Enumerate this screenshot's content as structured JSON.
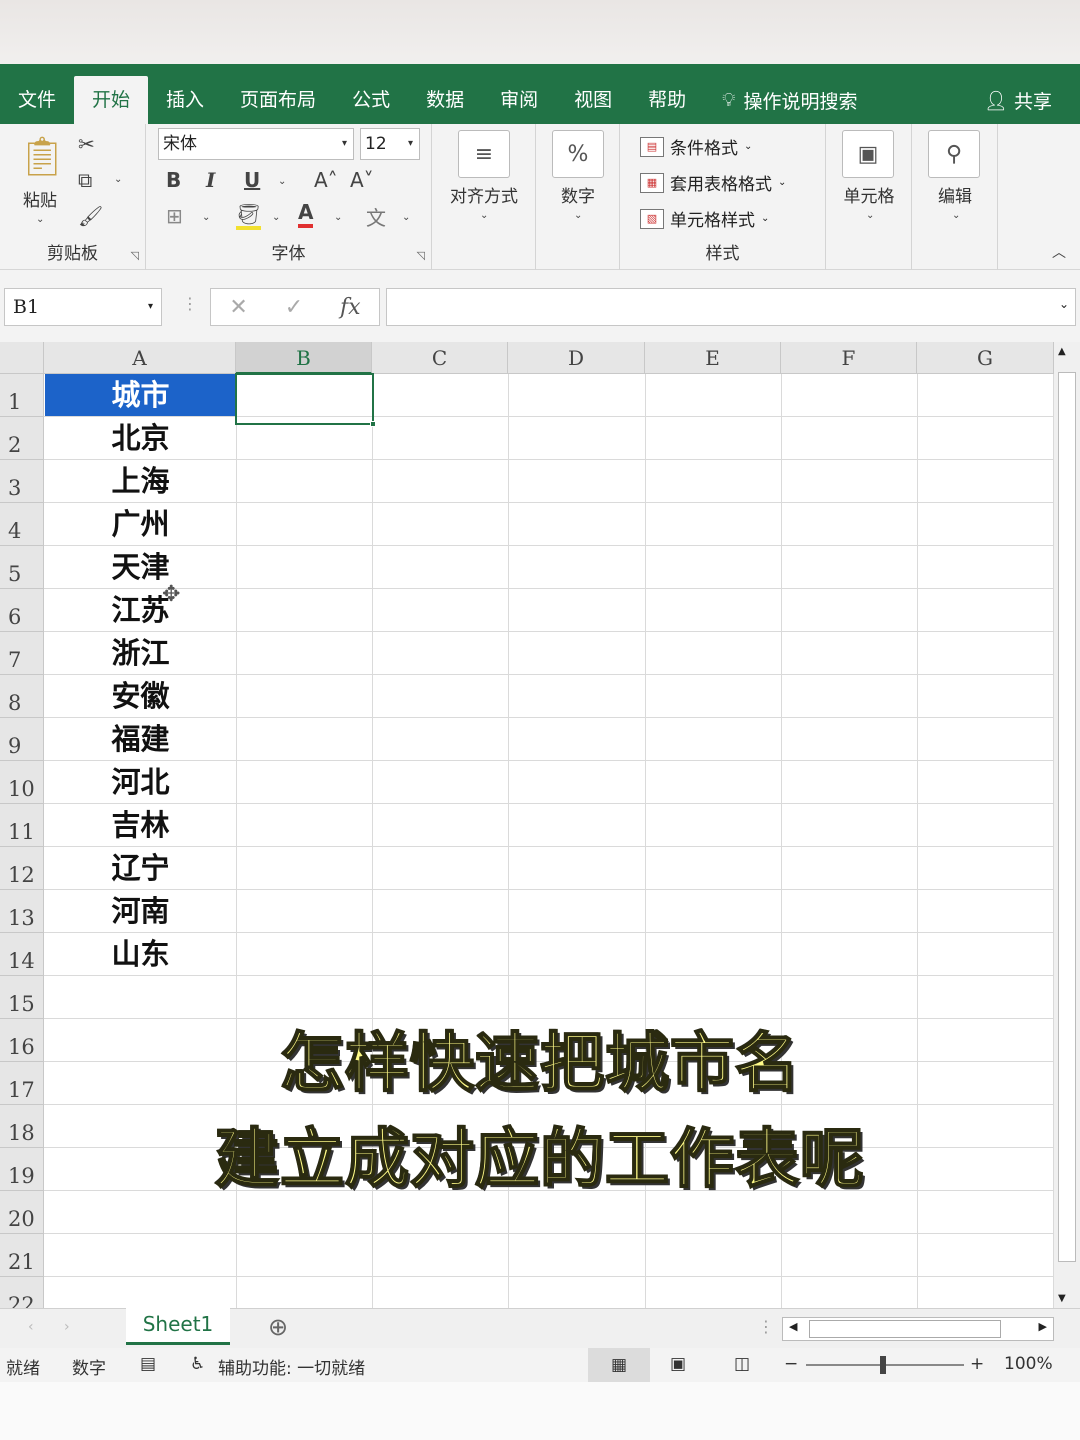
{
  "tabs": [
    "文件",
    "开始",
    "插入",
    "页面布局",
    "公式",
    "数据",
    "审阅",
    "视图",
    "帮助"
  ],
  "active_tab": "开始",
  "tell_me": "操作说明搜索",
  "share": "共享",
  "ribbon": {
    "clipboard": {
      "paste": "粘贴",
      "label": "剪贴板"
    },
    "font": {
      "name": "宋体",
      "size": "12",
      "bold": "B",
      "italic": "I",
      "underline": "U",
      "label": "字体"
    },
    "alignment": {
      "label": "对齐方式"
    },
    "number": {
      "label": "数字",
      "icon_text": "%"
    },
    "styles": {
      "conditional": "条件格式",
      "table": "套用表格格式",
      "cell_styles": "单元格样式",
      "label": "样式"
    },
    "cells": {
      "label": "单元格"
    },
    "editing": {
      "label": "编辑"
    }
  },
  "name_box": "B1",
  "fx": "fx",
  "columns": [
    "A",
    "B",
    "C",
    "D",
    "E",
    "F",
    "G"
  ],
  "rows": [
    "1",
    "2",
    "3",
    "4",
    "5",
    "6",
    "7",
    "8",
    "9",
    "10",
    "11",
    "12",
    "13",
    "14",
    "15",
    "16",
    "17",
    "18",
    "19",
    "20",
    "21",
    "22"
  ],
  "cells_a": [
    "城市",
    "北京",
    "上海",
    "广州",
    "天津",
    "江苏",
    "浙江",
    "安徽",
    "福建",
    "河北",
    "吉林",
    "辽宁",
    "河南",
    "山东"
  ],
  "caption": {
    "line1": "怎样快速把城市名",
    "line2": "建立成对应的工作表呢"
  },
  "sheet_tab": "Sheet1",
  "status": {
    "ready": "就绪",
    "mode": "数字",
    "accessibility": "辅助功能: 一切就绪",
    "zoom": "100%"
  },
  "colors": {
    "excel_green": "#217346",
    "header_fill": "#1c63c9",
    "caption_fill": "#fffb88"
  }
}
